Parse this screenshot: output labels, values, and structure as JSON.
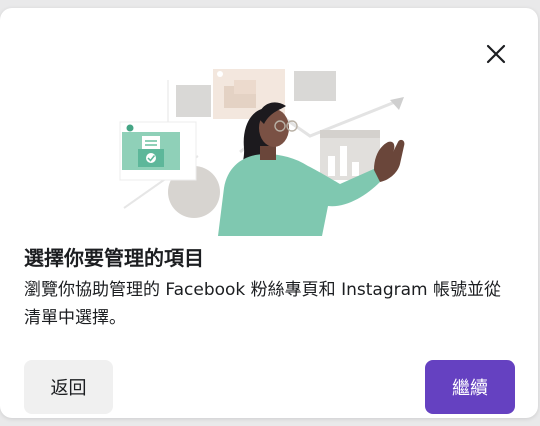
{
  "dialog": {
    "title": "選擇你要管理的項目",
    "description": "瀏覽你協助管理的 Facebook 粉絲專頁和 Instagram 帳號並從清單中選擇。",
    "close_icon": "close-icon",
    "illustration": "person-presenting-dashboard-illustration"
  },
  "actions": {
    "back_label": "返回",
    "continue_label": "繼續"
  },
  "colors": {
    "primary": "#6541c1",
    "secondary_button_bg": "#f0f0f0",
    "text": "#1c1e21",
    "illustration_teal": "#7fc8b0"
  }
}
